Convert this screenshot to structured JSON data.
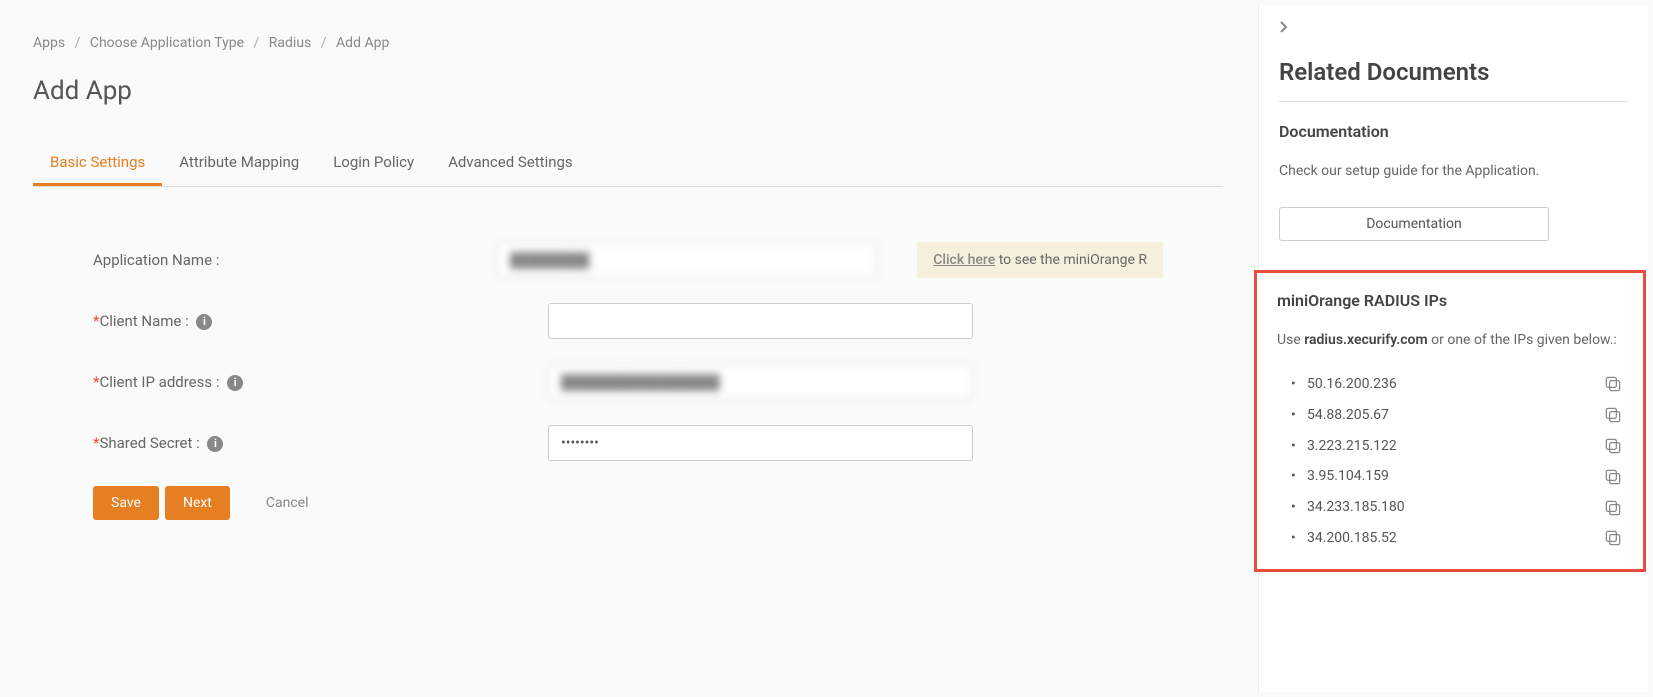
{
  "breadcrumb": {
    "apps": "Apps",
    "choose_type": "Choose Application Type",
    "radius": "Radius",
    "add_app": "Add App"
  },
  "page_title": "Add App",
  "tabs": {
    "basic": "Basic Settings",
    "attribute": "Attribute Mapping",
    "login": "Login Policy",
    "advanced": "Advanced Settings"
  },
  "form": {
    "app_name_label": "Application Name :",
    "app_name_value": "████████",
    "client_name_label": "Client Name :",
    "client_name_value": "",
    "client_ip_label": "Client IP address :",
    "client_ip_value": "████████████████",
    "shared_secret_label": "Shared Secret :",
    "shared_secret_value": "••••••••"
  },
  "click_here": {
    "link": "Click here",
    "text": " to see the miniOrange R"
  },
  "buttons": {
    "save": "Save",
    "next": "Next",
    "cancel": "Cancel"
  },
  "panel": {
    "title": "Related Documents",
    "doc_heading": "Documentation",
    "doc_text": "Check our setup guide for the Application.",
    "doc_button": "Documentation"
  },
  "ips": {
    "title": "miniOrange RADIUS IPs",
    "use": "Use ",
    "domain": "radius.xecurify.com",
    "suffix": " or one of the IPs given below.:",
    "list": [
      "50.16.200.236",
      "54.88.205.67",
      "3.223.215.122",
      "3.95.104.159",
      "34.233.185.180",
      "34.200.185.52"
    ]
  }
}
